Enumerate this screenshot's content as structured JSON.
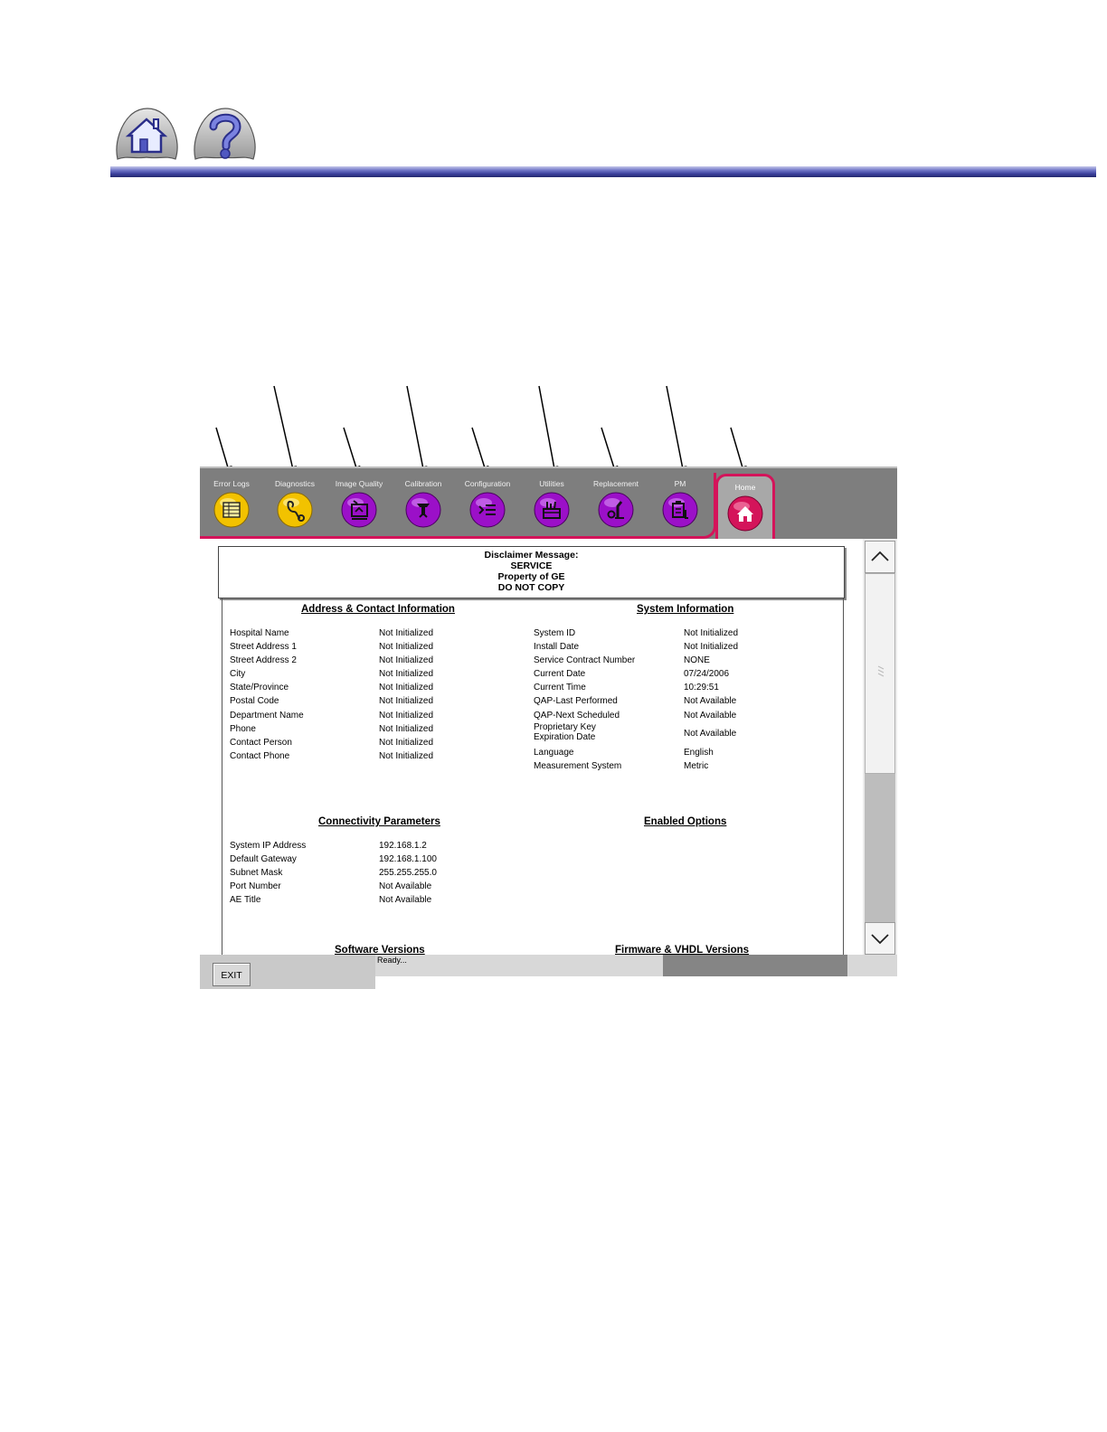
{
  "manual_header": {
    "home_button": "home-icon",
    "help_button": "question-mark-icon"
  },
  "tabs": [
    {
      "label": "Error Logs",
      "icon": "log-table-icon",
      "color": "#f2c200"
    },
    {
      "label": "Diagnostics",
      "icon": "stethoscope-icon",
      "color": "#f2c200"
    },
    {
      "label": "Image Quality",
      "icon": "image-quality-icon",
      "color": "#9b10c8"
    },
    {
      "label": "Calibration",
      "icon": "calibration-icon",
      "color": "#9b10c8"
    },
    {
      "label": "Configuration",
      "icon": "configuration-icon",
      "color": "#9b10c8"
    },
    {
      "label": "Utilities",
      "icon": "toolbox-icon",
      "color": "#9b10c8"
    },
    {
      "label": "Replacement",
      "icon": "wrench-icon",
      "color": "#9b10c8"
    },
    {
      "label": "PM",
      "icon": "clipboard-icon",
      "color": "#9b10c8"
    },
    {
      "label": "Home",
      "icon": "home-icon",
      "color": "#d4145a"
    }
  ],
  "disclaimer": {
    "line1": "Disclaimer Message:",
    "line2": "SERVICE",
    "line3": "Property of GE",
    "line4": "DO NOT COPY"
  },
  "address": {
    "title": "Address & Contact Information",
    "rows": [
      {
        "label": "Hospital Name",
        "value": "Not Initialized"
      },
      {
        "label": "Street Address 1",
        "value": "Not Initialized"
      },
      {
        "label": "Street Address 2",
        "value": "Not Initialized"
      },
      {
        "label": "City",
        "value": "Not Initialized"
      },
      {
        "label": "State/Province",
        "value": "Not Initialized"
      },
      {
        "label": "Postal Code",
        "value": "Not Initialized"
      },
      {
        "label": "Department Name",
        "value": "Not Initialized"
      },
      {
        "label": "Phone",
        "value": "Not Initialized"
      },
      {
        "label": "Contact Person",
        "value": "Not Initialized"
      },
      {
        "label": "Contact Phone",
        "value": "Not Initialized"
      }
    ]
  },
  "system": {
    "title": "System Information",
    "rows": [
      {
        "label": "System ID",
        "value": "Not Initialized"
      },
      {
        "label": "Install Date",
        "value": "Not Initialized"
      },
      {
        "label": "Service Contract Number",
        "value": "NONE"
      },
      {
        "label": "Current Date",
        "value": "07/24/2006"
      },
      {
        "label": "Current Time",
        "value": "10:29:51"
      },
      {
        "label": "QAP-Last Performed",
        "value": "Not Available"
      },
      {
        "label": "QAP-Next Scheduled",
        "value": "Not Available"
      },
      {
        "label": "Proprietary Key",
        "label2": "Expiration Date",
        "value": "Not Available"
      },
      {
        "label": "Language",
        "value": "English"
      },
      {
        "label": "Measurement System",
        "value": "Metric"
      }
    ]
  },
  "connectivity": {
    "title": "Connectivity Parameters",
    "rows": [
      {
        "label": "System IP Address",
        "value": "192.168.1.2"
      },
      {
        "label": "Default Gateway",
        "value": "192.168.1.100"
      },
      {
        "label": "Subnet Mask",
        "value": "255.255.255.0"
      },
      {
        "label": "Port Number",
        "value": "Not Available"
      },
      {
        "label": "AE Title",
        "value": "Not Available"
      }
    ]
  },
  "options": {
    "title": "Enabled Options"
  },
  "software": {
    "title": "Software Versions"
  },
  "firmware": {
    "title": "Firmware & VHDL Versions"
  },
  "footer": {
    "exit_label": "EXIT",
    "status_text": "Ready..."
  },
  "scrollbar": {
    "up_icon": "chevron-up-icon",
    "down_icon": "chevron-down-icon",
    "grip_icon": "grip-icon"
  }
}
